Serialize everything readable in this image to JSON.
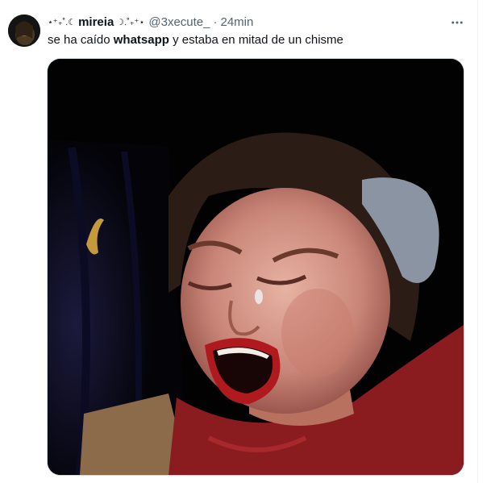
{
  "tweet": {
    "decor_left": "⋆⁺₊˚.☾",
    "display_name": "mireia",
    "decor_right": "☽.˚₊⁺⋆",
    "handle": "@3xecute_",
    "separator": "·",
    "time": "24min",
    "text_before": "se ha caído ",
    "text_bold": "whatsapp",
    "text_after": " y estaba en mitad de un chisme",
    "media_icon": "crying-woman-photo",
    "more_icon": "more-horizontal-icon",
    "avatar_icon": "user-avatar"
  },
  "colors": {
    "text": "#0f1419",
    "secondary": "#536471",
    "border": "#cfd9de"
  }
}
